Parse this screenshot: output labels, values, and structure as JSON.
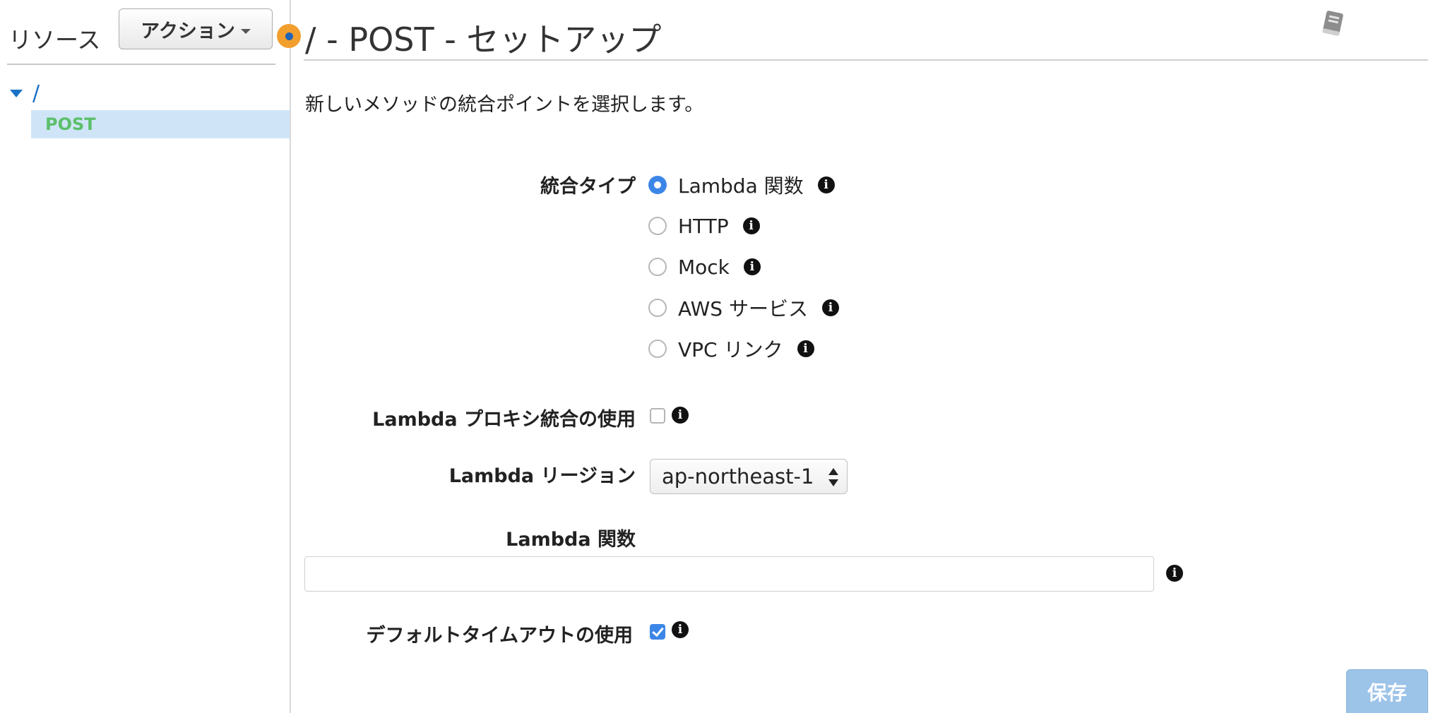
{
  "sidebar": {
    "title": "リソース",
    "actions_label": "アクション",
    "tree": {
      "root_label": "/",
      "items": [
        {
          "label": "POST"
        }
      ]
    }
  },
  "main": {
    "title": "/ - POST - セットアップ",
    "subtitle": "新しいメソッドの統合ポイントを選択します。",
    "integration_type": {
      "label": "統合タイプ",
      "options": [
        {
          "label": "Lambda 関数",
          "selected": true
        },
        {
          "label": "HTTP",
          "selected": false
        },
        {
          "label": "Mock",
          "selected": false
        },
        {
          "label": "AWS サービス",
          "selected": false
        },
        {
          "label": "VPC リンク",
          "selected": false
        }
      ]
    },
    "lambda_proxy": {
      "label": "Lambda プロキシ統合の使用",
      "checked": false
    },
    "lambda_region": {
      "label": "Lambda リージョン",
      "value": "ap-northeast-1"
    },
    "lambda_function": {
      "label": "Lambda 関数",
      "value": ""
    },
    "default_timeout": {
      "label": "デフォルトタイムアウトの使用",
      "checked": true
    },
    "save_label": "保存",
    "info_glyph": "i"
  },
  "icons": {
    "documentation": "book-icon",
    "info": "info-icon",
    "tree_caret": "caret-down-icon",
    "status": "orange-dot-icon"
  },
  "colors": {
    "accent": "#3c86e8",
    "link": "#1a6fc2",
    "selected_row_bg": "#cfe5f7",
    "resource_method_text": "#5cbf6b",
    "status_dot": "#f29f2e",
    "save_button_bg": "#9cc3e8"
  }
}
